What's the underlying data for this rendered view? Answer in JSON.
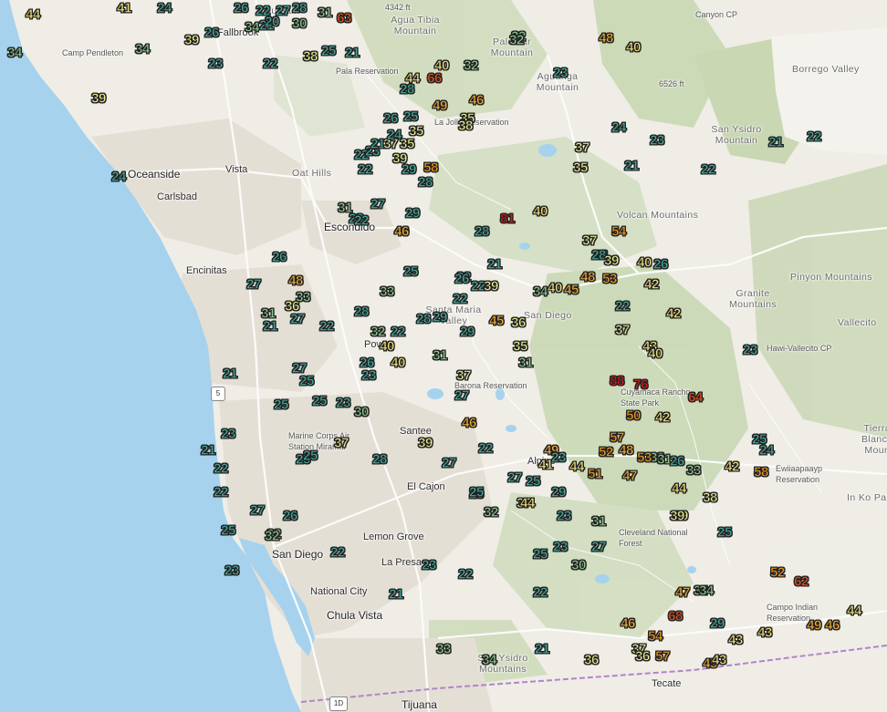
{
  "map": {
    "colors": {
      "ocean": "#a6d2ee",
      "land": "#efede6",
      "relief": "#c9d8b6",
      "desert": "#f3f2ec",
      "urban": "#e6e1d8",
      "road_major": "#f8f8f8",
      "border": "#b283c9",
      "lake": "#a6d2ee",
      "t20s": "#44a89a",
      "t30low": "#8cc78d",
      "t30high": "#e9ec8e",
      "t40low": "#f4e27a",
      "t40high": "#f3ae35",
      "t50s": "#f09a1e",
      "t60s": "#e5521f",
      "t70plus": "#cf1b1b"
    },
    "places": [
      {
        "name": "Oceanside",
        "kind": "city"
      },
      {
        "name": "Vista",
        "kind": "town"
      },
      {
        "name": "Carlsbad",
        "kind": "town"
      },
      {
        "name": "Encinitas",
        "kind": "town"
      },
      {
        "name": "Escondido",
        "kind": "city"
      },
      {
        "name": "Poway",
        "kind": "town"
      },
      {
        "name": "Santee",
        "kind": "town"
      },
      {
        "name": "El Cajon",
        "kind": "town"
      },
      {
        "name": "Lemon Grove",
        "kind": "town"
      },
      {
        "name": "San Diego",
        "kind": "city"
      },
      {
        "name": "La Presa",
        "kind": "town"
      },
      {
        "name": "National City",
        "kind": "town"
      },
      {
        "name": "Chula Vista",
        "kind": "city"
      },
      {
        "name": "Tijuana",
        "kind": "city"
      },
      {
        "name": "Tecate",
        "kind": "town"
      },
      {
        "name": "Alpine",
        "kind": "town"
      },
      {
        "name": "Fallbrook",
        "kind": "town"
      },
      {
        "name": "Camp Pendleton",
        "kind": "small"
      },
      {
        "name": "Pala Reservation",
        "kind": "small"
      },
      {
        "name": "La Jolla Reservation",
        "kind": "small"
      },
      {
        "name": "Marine Corps Air Station Miramar",
        "kind": "small"
      },
      {
        "name": "Barona Reservation",
        "kind": "small"
      },
      {
        "name": "Cleveland National Forest",
        "kind": "small"
      },
      {
        "name": "Cuyamaca Rancho State Park",
        "kind": "small"
      },
      {
        "name": "Ewiiaapaayp Reservation",
        "kind": "small"
      },
      {
        "name": "Campo Indian Reservation",
        "kind": "small"
      },
      {
        "name": "Hawi-Vallecito CP",
        "kind": "small"
      },
      {
        "name": "Canyon CP",
        "kind": "small"
      },
      {
        "name": "Agua Tibia Mountain",
        "kind": "mtn"
      },
      {
        "name": "Palomar Mountain",
        "kind": "mtn"
      },
      {
        "name": "Aguanga Mountain",
        "kind": "mtn"
      },
      {
        "name": "Oat Hills",
        "kind": "mtn"
      },
      {
        "name": "Volcan Mountains",
        "kind": "mtn"
      },
      {
        "name": "San Ysidro Mountain",
        "kind": "mtn"
      },
      {
        "name": "Borrego Valley",
        "kind": "mtn"
      },
      {
        "name": "Santa Maria Valley",
        "kind": "mtn"
      },
      {
        "name": "San Diego",
        "kind": "mtn"
      },
      {
        "name": "Pinyon Mountains",
        "kind": "mtn"
      },
      {
        "name": "Granite Mountains",
        "kind": "mtn"
      },
      {
        "name": "Vallecito",
        "kind": "mtn"
      },
      {
        "name": "In Ko Pa",
        "kind": "mtn"
      },
      {
        "name": "Tierra Blanca Moun",
        "kind": "mtn"
      },
      {
        "name": "San Ysidro Mountains",
        "kind": "mtn"
      },
      {
        "name": "Mountain",
        "kind": "mtn"
      },
      {
        "name": "6526 ft",
        "kind": "small"
      },
      {
        "name": "4342 ft",
        "kind": "small"
      }
    ],
    "shields": [
      "5",
      "1D"
    ],
    "observations": [
      "44",
      "41",
      "24",
      "26",
      "22",
      "27",
      "28",
      "31",
      "63",
      "34",
      "39",
      "26",
      "21",
      "34",
      "30",
      "20",
      "34",
      "23",
      "22",
      "38",
      "25",
      "21",
      "32",
      "48",
      "40",
      "32",
      "40",
      "39",
      "28",
      "44",
      "66",
      "32",
      "23",
      "49",
      "46",
      "26",
      "25",
      "35",
      "35",
      "38",
      "24",
      "23",
      "21",
      "22",
      "22",
      "23",
      "21",
      "37",
      "35",
      "24",
      "39",
      "37",
      "35",
      "21",
      "22",
      "24",
      "22",
      "29",
      "58",
      "28",
      "31",
      "27",
      "29",
      "28",
      "81",
      "40",
      "40",
      "22",
      "46",
      "54",
      "26",
      "37",
      "28",
      "39",
      "21",
      "40",
      "26",
      "28",
      "26",
      "25",
      "48",
      "53",
      "22",
      "22",
      "39",
      "40",
      "45",
      "34",
      "42",
      "48",
      "27",
      "36",
      "33",
      "26",
      "22",
      "28",
      "42",
      "42",
      "22",
      "33",
      "27",
      "22",
      "21",
      "31",
      "28",
      "29",
      "45",
      "36",
      "37",
      "32",
      "22",
      "40",
      "31",
      "35",
      "43",
      "29",
      "40",
      "26",
      "31",
      "40",
      "25",
      "23",
      "37",
      "23",
      "21",
      "25",
      "88",
      "76",
      "64",
      "30",
      "21",
      "25",
      "23",
      "27",
      "46",
      "50",
      "42",
      "27",
      "23",
      "37",
      "39",
      "22",
      "49",
      "23",
      "57",
      "52",
      "48",
      "33",
      "53",
      "31",
      "26",
      "42",
      "58",
      "25",
      "24",
      "21",
      "25",
      "28",
      "27",
      "41",
      "44",
      "51",
      "47",
      "33",
      "25",
      "22",
      "25",
      "22",
      "27",
      "25",
      "37",
      "29",
      "39",
      "44",
      "38",
      "27",
      "26",
      "32",
      "25",
      "32",
      "44",
      "23",
      "31",
      "27",
      "39",
      "25",
      "25",
      "32",
      "22",
      "23",
      "25",
      "30",
      "34",
      "52",
      "62",
      "23",
      "23",
      "22",
      "22",
      "47",
      "34",
      "21",
      "46",
      "68",
      "29",
      "43",
      "49",
      "46",
      "44",
      "33",
      "34",
      "21",
      "36",
      "37",
      "36",
      "57",
      "43",
      "45",
      "54",
      "43"
    ]
  }
}
